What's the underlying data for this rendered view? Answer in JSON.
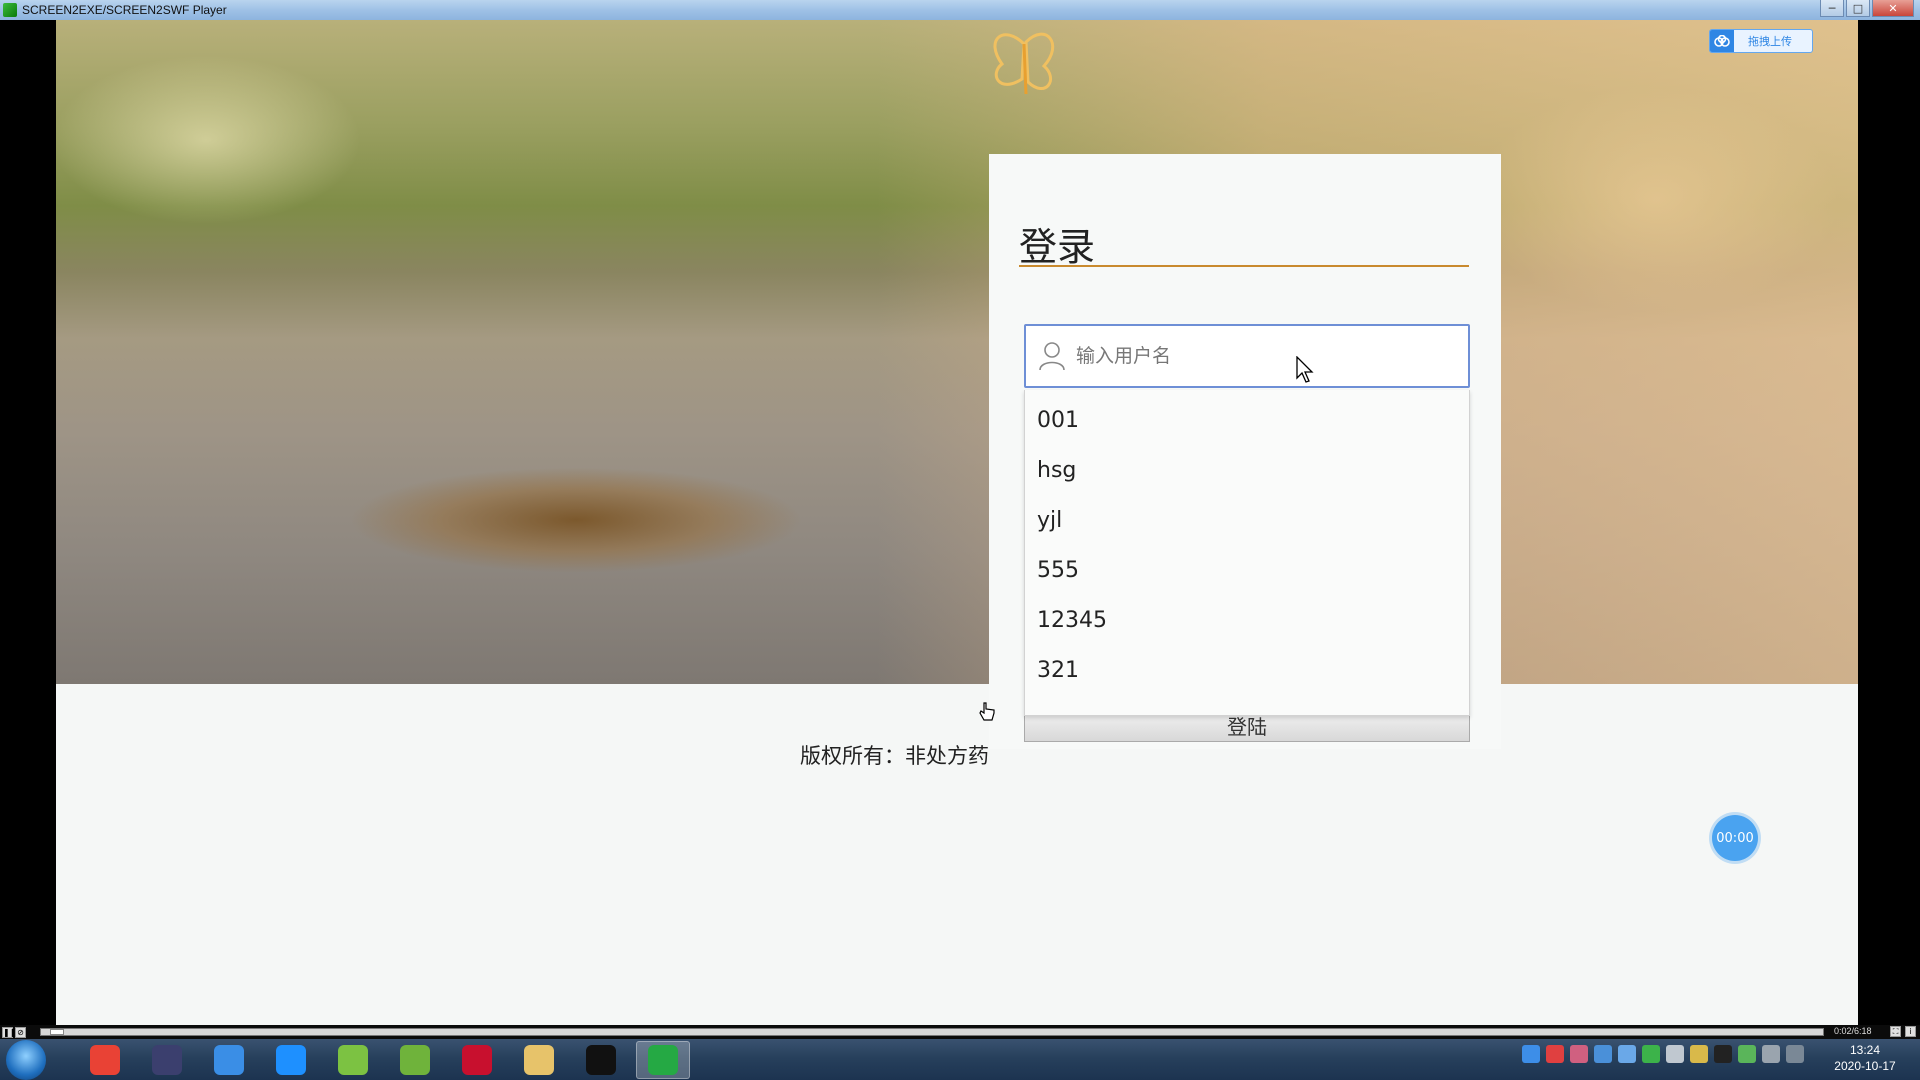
{
  "window": {
    "title": "SCREEN2EXE/SCREEN2SWF Player",
    "minimize": "─",
    "maximize": "□",
    "close": "✕"
  },
  "page": {
    "upload_button": "拖拽上传",
    "login_title": "登录",
    "username_placeholder": "输入用户名",
    "username_value": "",
    "autocomplete_options": [
      "001",
      "hsg",
      "yjl",
      "555",
      "12345",
      "321"
    ],
    "login_button": "登陆",
    "copyright": "版权所有：非处方药"
  },
  "timer_badge": "00:00",
  "player": {
    "elapsed_total": "0:02/6:18",
    "progress": 0.005
  },
  "taskbar": {
    "apps": [
      {
        "name": "chrome-icon",
        "color": "#e94235"
      },
      {
        "name": "eclipse-icon",
        "color": "#3b3f6e"
      },
      {
        "name": "baidu-netdisk-icon",
        "color": "#3a8ee6"
      },
      {
        "name": "browser-icon",
        "color": "#1e90ff"
      },
      {
        "name": "leaf-app-icon",
        "color": "#7cc242"
      },
      {
        "name": "notepad-icon",
        "color": "#6fb33b"
      },
      {
        "name": "flash-icon",
        "color": "#c8102e"
      },
      {
        "name": "file-explorer-icon",
        "color": "#e7c36a"
      },
      {
        "name": "qq-icon",
        "color": "#111111"
      },
      {
        "name": "screen2exe-icon",
        "color": "#25a944"
      }
    ],
    "active_app_index": 9,
    "clock_time": "13:24",
    "clock_date": "2020-10-17"
  }
}
